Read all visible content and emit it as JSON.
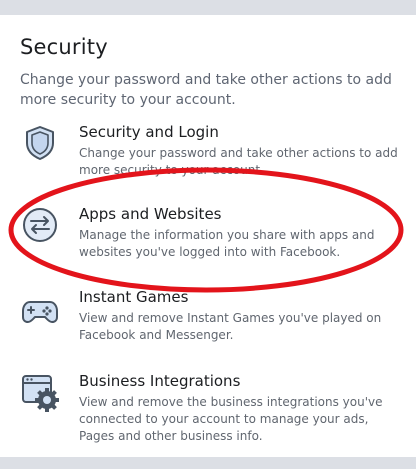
{
  "section": {
    "title": "Security",
    "description": "Change your password and take other actions to add more security to your account."
  },
  "items": [
    {
      "icon": "shield-icon",
      "title": "Security and Login",
      "description": "Change your password and take other actions to add more security to your account."
    },
    {
      "icon": "arrows-swap-icon",
      "title": "Apps and Websites",
      "description": "Manage the information you share with apps and websites you've logged into with Facebook."
    },
    {
      "icon": "gamepad-icon",
      "title": "Instant Games",
      "description": "View and remove Instant Games you've played on Facebook and Messenger."
    },
    {
      "icon": "window-gear-icon",
      "title": "Business Integrations",
      "description": "View and remove the business integrations you've connected to your account to manage your ads, Pages and other business info."
    }
  ],
  "colors": {
    "background": "#dcdfe5",
    "panel": "#ffffff",
    "highlight": "#e3141b",
    "icon_fill": "#d2e1f4",
    "icon_stroke": "#485462"
  }
}
